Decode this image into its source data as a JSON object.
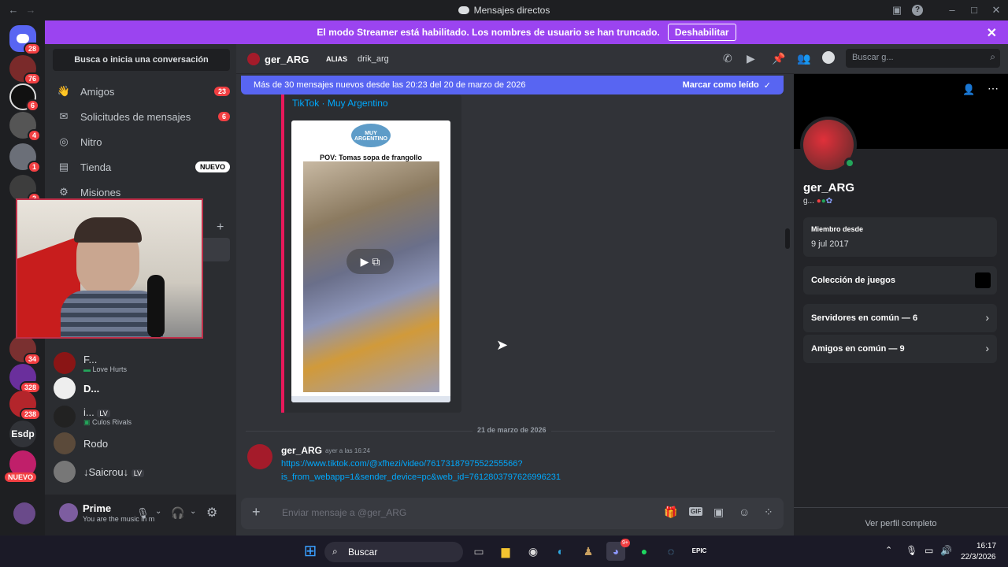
{
  "window": {
    "title": "Mensajes directos"
  },
  "servers": [
    {
      "name": "discord-home",
      "badge": "28"
    },
    {
      "name": "server-1",
      "badge": "76"
    },
    {
      "name": "server-2",
      "badge": "6"
    },
    {
      "name": "server-3",
      "badge": "4"
    },
    {
      "name": "server-4",
      "badge": "1"
    },
    {
      "name": "server-5",
      "badge": "2"
    },
    {
      "name": "server-6",
      "badge": "34"
    },
    {
      "name": "server-7",
      "badge": "328"
    },
    {
      "name": "server-8",
      "badge": "238"
    },
    {
      "name": "server-esdp",
      "label": "Esdp"
    },
    {
      "name": "server-new",
      "label": "NUEVO"
    }
  ],
  "streamer": {
    "message": "El modo Streamer está habilitado. Los nombres de usuario se han truncado.",
    "button": "Deshabilitar"
  },
  "dm_panel": {
    "search": "Busca o inicia una conversación",
    "nav": [
      {
        "label": "Amigos",
        "count": "23",
        "icon": "friends-icon"
      },
      {
        "label": "Solicitudes de mensajes",
        "count": "6",
        "icon": "envelope-icon"
      },
      {
        "label": "Nitro",
        "icon": "nitro-icon"
      },
      {
        "label": "Tienda",
        "tag": "NUEVO",
        "icon": "shop-icon"
      },
      {
        "label": "Misiones",
        "icon": "quests-icon"
      }
    ],
    "dms": [
      {
        "name": "F...",
        "status": "Love Hurts"
      },
      {
        "name": "D..."
      },
      {
        "name": "i...",
        "tag": "LV",
        "status": "Culos Rivals"
      },
      {
        "name": "Rodo"
      },
      {
        "name": "↓Saicrou↓",
        "tag": "LV"
      }
    ]
  },
  "user": {
    "name": "Prime",
    "status": "You are the music in m"
  },
  "chat": {
    "username": "ger_ARG",
    "alias_label": "ALIAS",
    "alias": "drik_arg",
    "search_placeholder": "Buscar g...",
    "new_messages": "Más de 30 mensajes nuevos desde las 20:23 del 20 de marzo de 2026",
    "mark_read": "Marcar como leído",
    "embed_title": "TikTok · Muy Argentino",
    "video_brand": "MUY ARGENTINO",
    "video_caption": "POV: Tomas sopa de frangollo",
    "date_divider": "21 de marzo de 2026",
    "message_author": "ger_ARG",
    "message_time": "ayer a las 16:24",
    "message_link_1": "https://www.tiktok.com/@xfhezi/video/7617318797552255566?",
    "message_link_2": "is_from_webapp=1&sender_device=pc&web_id=7612803797626996231",
    "composer_placeholder": "Enviar mensaje a @ger_ARG"
  },
  "profile": {
    "name": "ger_ARG",
    "short": "g...",
    "member_since_label": "Miembro desde",
    "member_since": "9 jul 2017",
    "games": "Colección de juegos",
    "servers": "Servidores en común — 6",
    "friends": "Amigos en común — 9",
    "view_full": "Ver perfil completo"
  },
  "taskbar": {
    "search": "Buscar",
    "time": "16:17",
    "date": "22/3/2026",
    "discord_badge": "9+"
  }
}
